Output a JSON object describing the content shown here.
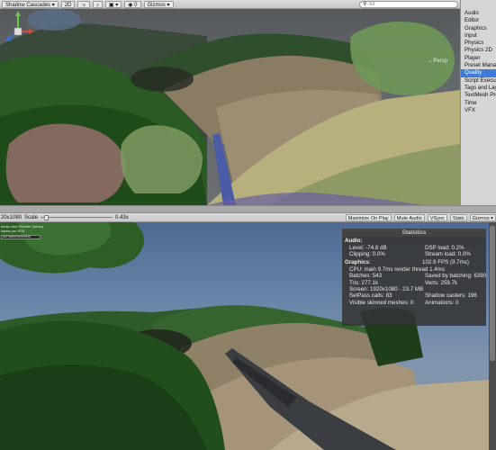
{
  "scene_toolbar": {
    "shading_mode": "Shadow Cascades",
    "mode_2d": "2D",
    "lighting_icon": "sun-icon",
    "audio_icon": "speaker-icon",
    "effects_icon": "image-icon",
    "hidden_count": "0",
    "gizmos_label": "Gizmos",
    "search_icon": "search-icon",
    "search_value": "All"
  },
  "scene_view": {
    "projection_label": "←Persp"
  },
  "project_settings": {
    "items": [
      {
        "label": "Audio",
        "selected": false
      },
      {
        "label": "Editor",
        "selected": false
      },
      {
        "label": "Graphics",
        "selected": false
      },
      {
        "label": "Input",
        "selected": false
      },
      {
        "label": "Physics",
        "selected": false
      },
      {
        "label": "Physics 2D",
        "selected": false
      },
      {
        "label": "Player",
        "selected": false
      },
      {
        "label": "Preset Manager",
        "selected": false
      },
      {
        "label": "Quality",
        "selected": true
      },
      {
        "label": "Script Execution Order",
        "selected": false
      },
      {
        "label": "Tags and Layers",
        "selected": false
      },
      {
        "label": "TextMesh Pro",
        "selected": false
      },
      {
        "label": "Time",
        "selected": false
      },
      {
        "label": "VFX",
        "selected": false
      }
    ]
  },
  "game_toolbar": {
    "resolution": "20x1080",
    "scale_label": "Scale",
    "scale_value": "0.43x",
    "scale_fraction": 0.05,
    "maximize_on_play": "Maximize On Play",
    "mute_audio": "Mute Audio",
    "vsync": "VSync",
    "stats": "Stats",
    "gizmos": "Gizmos"
  },
  "debug_overlay": {
    "lines": [
      "terrain struc Forester Scenery",
      "frames per 2019"
    ],
    "box_text": "set frameincrement"
  },
  "statistics": {
    "title": "Statistics",
    "audio_heading": "Audio:",
    "level": "Level: -74.8 dB",
    "dsp_load": "DSP load: 0.2%",
    "clipping": "Clipping: 0.0%",
    "stream_load": "Stream load: 0.0%",
    "graphics_heading": "Graphics:",
    "fps": "102.9 FPS (9.7ms)",
    "cpu": "CPU: main 9.7ms  render thread 1.4ms",
    "batches": "Batches: 543",
    "saved_batching": "Saved by batching: 6390",
    "tris": "Tris: 277.1k",
    "verts": "Verts: 259.7k",
    "screen": "Screen: 1920x1080 - 23.7 MB",
    "setpass": "SetPass calls: 83",
    "shadow_casters": "Shadow casters: 196",
    "skinned": "Visible skinned meshes: 0",
    "animations": "Animations: 0"
  }
}
